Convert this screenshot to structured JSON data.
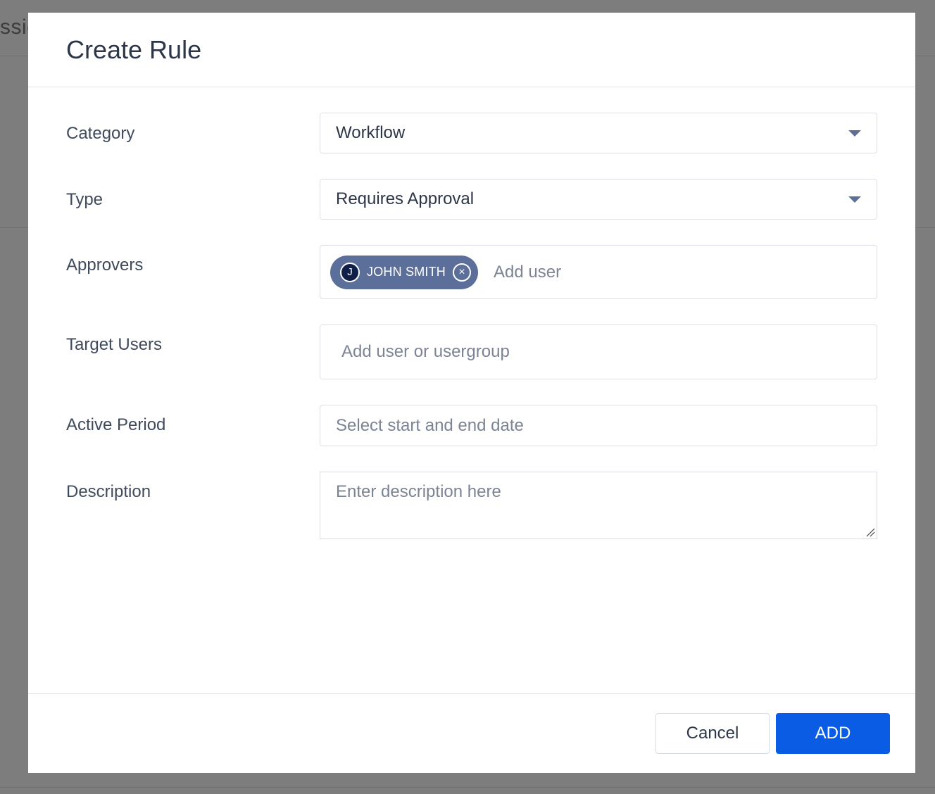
{
  "background": {
    "partial_text": "ssio"
  },
  "modal": {
    "title": "Create Rule",
    "fields": {
      "category": {
        "label": "Category",
        "value": "Workflow"
      },
      "type": {
        "label": "Type",
        "value": "Requires Approval"
      },
      "approvers": {
        "label": "Approvers",
        "chips": [
          {
            "initial": "J",
            "name": "JOHN SMITH"
          }
        ],
        "placeholder": "Add user"
      },
      "target_users": {
        "label": "Target Users",
        "placeholder": "Add user or usergroup"
      },
      "active_period": {
        "label": "Active Period",
        "placeholder": "Select start and end date"
      },
      "description": {
        "label": "Description",
        "placeholder": "Enter description here"
      }
    },
    "footer": {
      "cancel_label": "Cancel",
      "add_label": "ADD"
    }
  },
  "colors": {
    "overlay": "#7d7d7d",
    "primary": "#0b5ce5",
    "chip_bg": "#5c6f9a",
    "caret": "#5c6f96"
  },
  "icons": {
    "dropdown": "chevron-down-icon",
    "chip_remove": "close-circle-icon",
    "resize": "resize-grip-icon"
  }
}
